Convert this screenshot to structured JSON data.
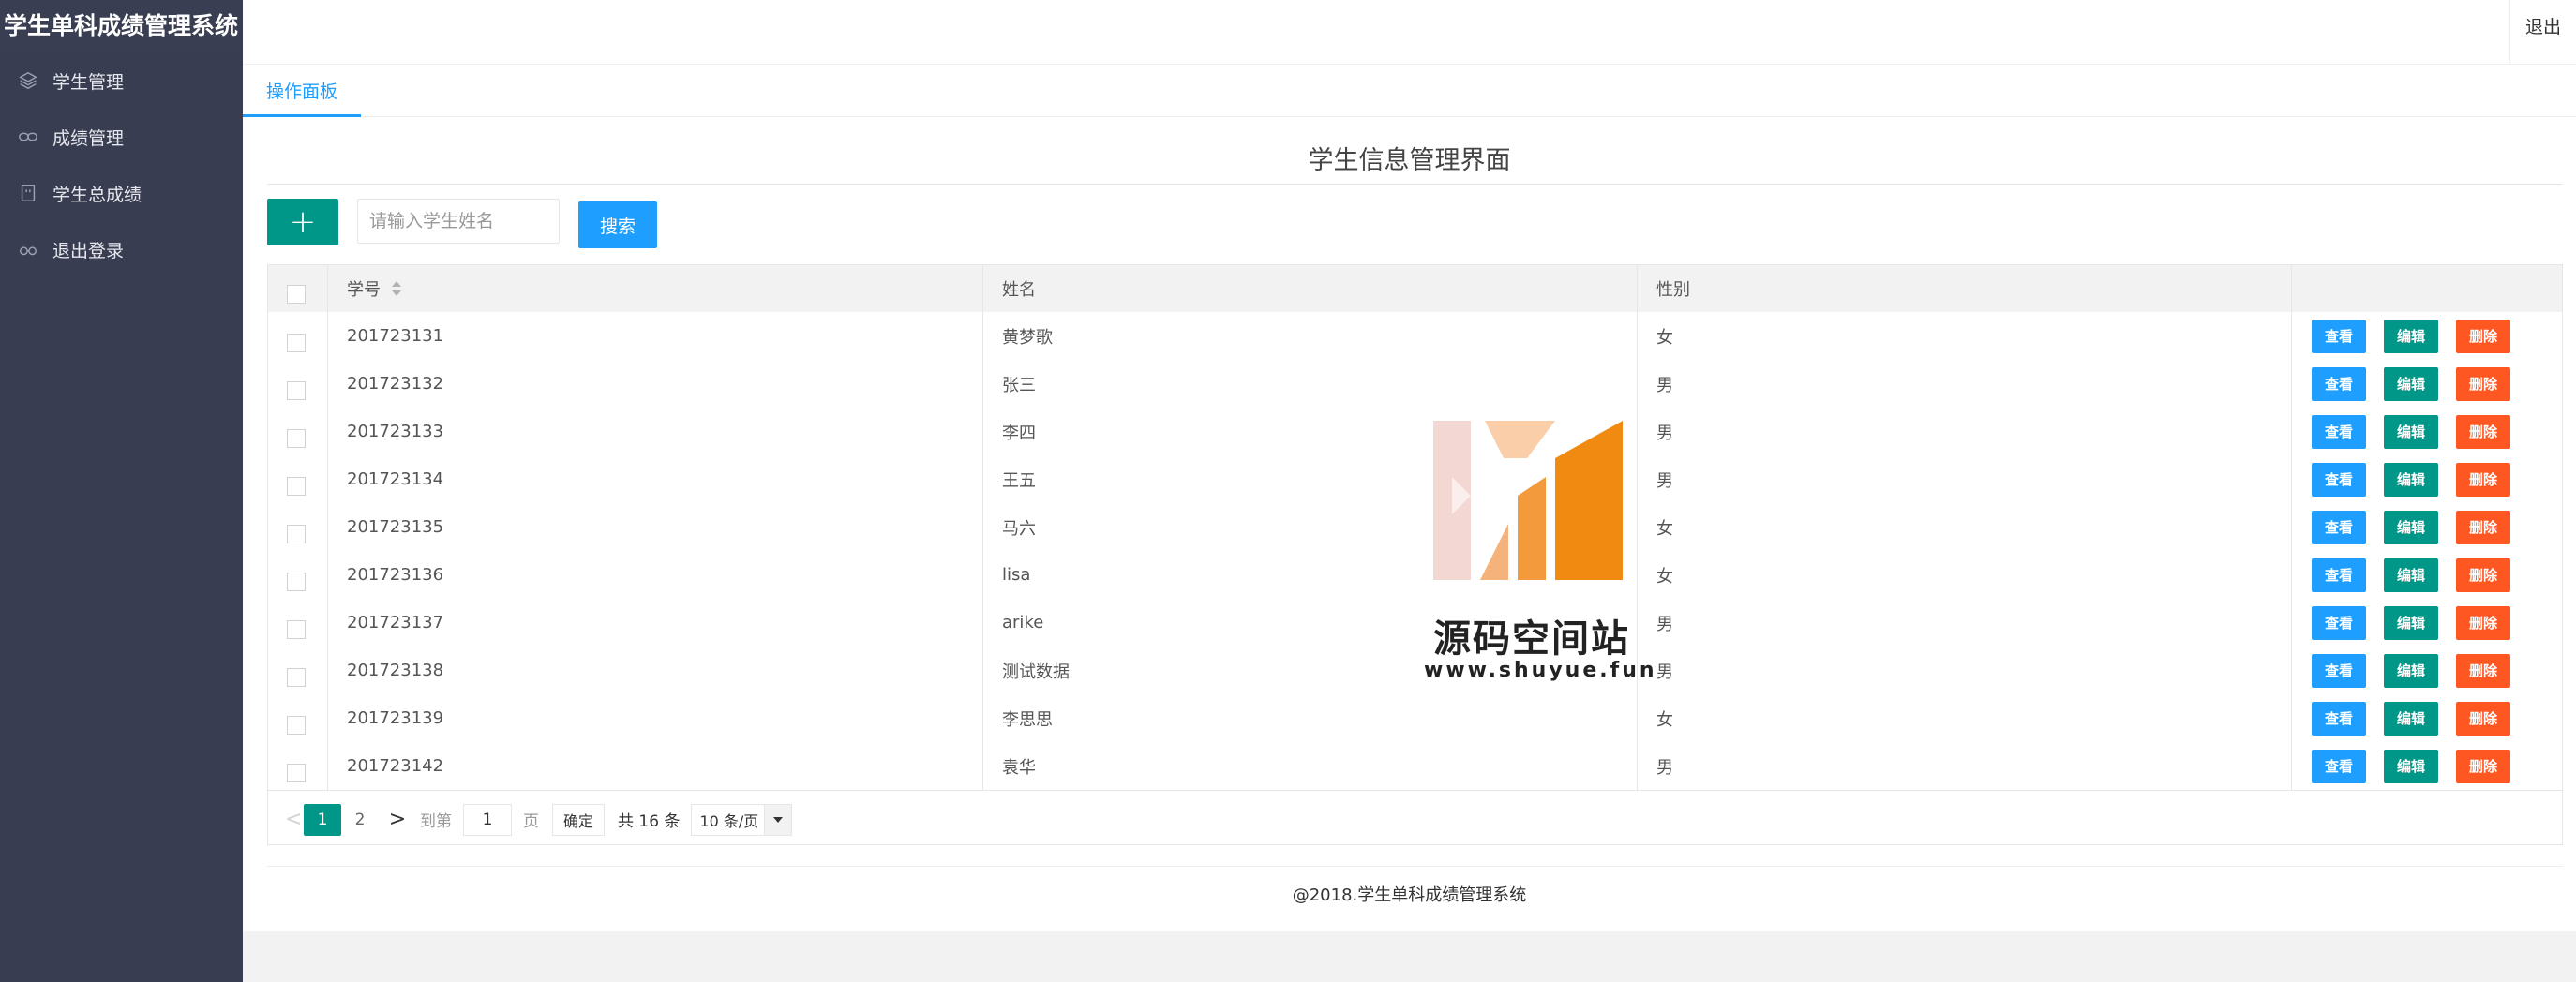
{
  "app": {
    "title": "学生单科成绩管理系统"
  },
  "sidebar": {
    "items": [
      {
        "label": "学生管理",
        "icon": "layers-icon"
      },
      {
        "label": "成绩管理",
        "icon": "link-icon"
      },
      {
        "label": "学生总成绩",
        "icon": "template-icon"
      },
      {
        "label": "退出登录",
        "icon": "glasses-icon"
      }
    ]
  },
  "header": {
    "logout_label": "退出"
  },
  "tabs": [
    {
      "label": "操作面板",
      "active": true
    }
  ],
  "page": {
    "title": "学生信息管理界面",
    "add_label": "+",
    "search_placeholder": "请输入学生姓名",
    "search_label": "搜索"
  },
  "table": {
    "columns": [
      "学号",
      "姓名",
      "性别"
    ],
    "actions": {
      "view": "查看",
      "edit": "编辑",
      "delete": "删除"
    },
    "rows": [
      {
        "id": "201723131",
        "name": "黄梦歌",
        "sex": "女"
      },
      {
        "id": "201723132",
        "name": "张三",
        "sex": "男"
      },
      {
        "id": "201723133",
        "name": "李四",
        "sex": "男"
      },
      {
        "id": "201723134",
        "name": "王五",
        "sex": "男"
      },
      {
        "id": "201723135",
        "name": "马六",
        "sex": "女"
      },
      {
        "id": "201723136",
        "name": "lisa",
        "sex": "女"
      },
      {
        "id": "201723137",
        "name": "arike",
        "sex": "男"
      },
      {
        "id": "201723138",
        "name": "测试数据",
        "sex": "男"
      },
      {
        "id": "201723139",
        "name": "李思思",
        "sex": "女"
      },
      {
        "id": "201723142",
        "name": "袁华",
        "sex": "男"
      }
    ]
  },
  "pager": {
    "prev": "<",
    "pages": [
      "1",
      "2"
    ],
    "current": "1",
    "next": ">",
    "goto_label": "到第",
    "goto_value": "1",
    "page_label": "页",
    "confirm_label": "确定",
    "total_label": "共 16 条",
    "limit_label": "10 条/页"
  },
  "footer": {
    "text": "@2018.学生单科成绩管理系统"
  },
  "watermark": {
    "name": "源码空间站",
    "url": "www.shuyue.fun"
  },
  "colors": {
    "sidebar": "#393d52",
    "primary_teal": "#009688",
    "primary_blue": "#1e9fff",
    "danger": "#ff5722"
  }
}
